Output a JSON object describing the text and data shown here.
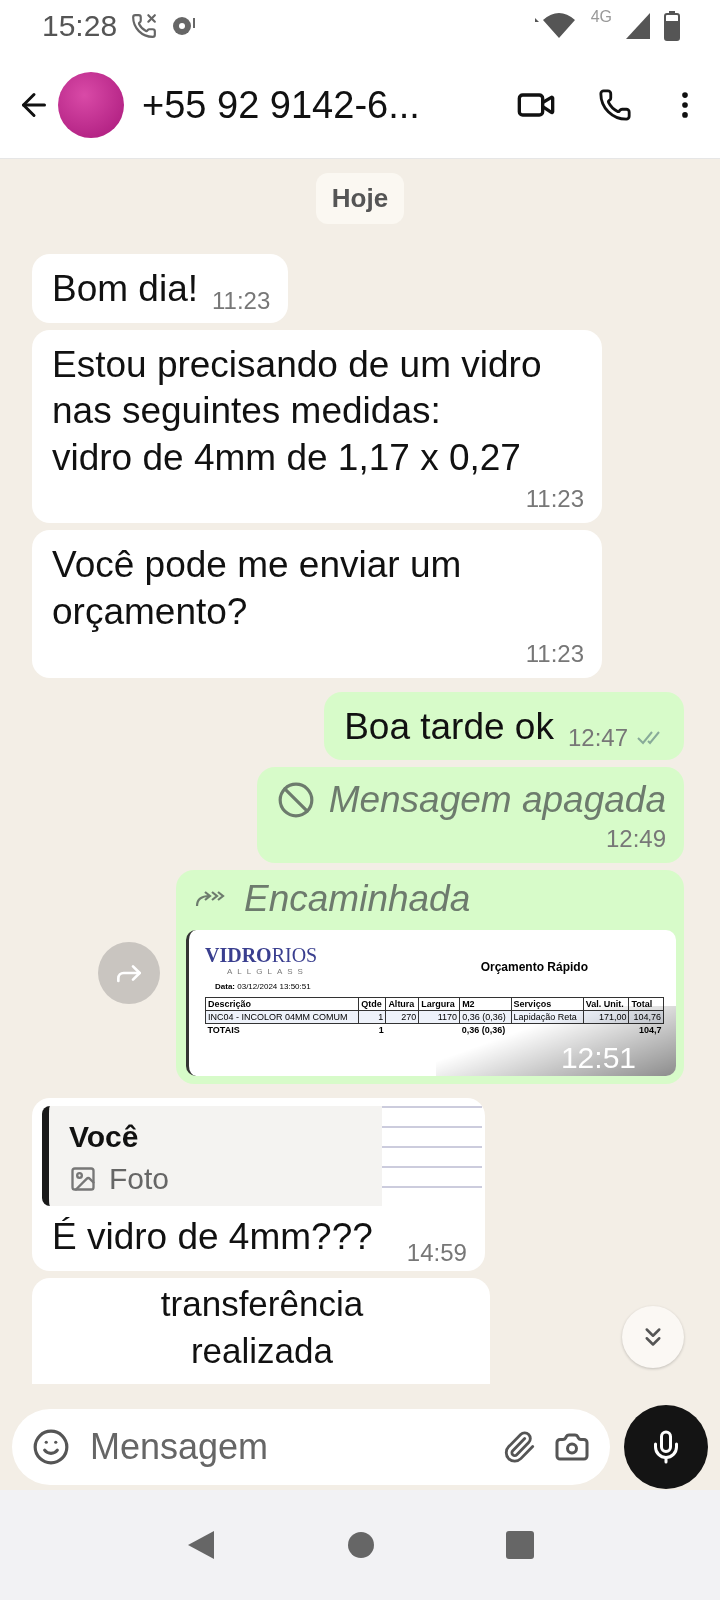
{
  "status_bar": {
    "time": "15:28",
    "network": "4G"
  },
  "header": {
    "title": "+55 92 9142-6..."
  },
  "date_chip": "Hoje",
  "messages": [
    {
      "kind": "text",
      "outgoing": false,
      "text": "Bom dia!",
      "time": "11:23",
      "time_below": false
    },
    {
      "kind": "text",
      "outgoing": false,
      "text": "Estou precisando de um vidro nas seguintes medidas:\nvidro de 4mm de 1,17 x 0,27",
      "time": "11:23",
      "time_below": true
    },
    {
      "kind": "text",
      "outgoing": false,
      "text": "Você pode me enviar um orçamento?",
      "time": "11:23",
      "time_below": true
    },
    {
      "kind": "text",
      "outgoing": true,
      "text": "Boa tarde ok",
      "time": "12:47",
      "time_below": false,
      "read": true
    },
    {
      "kind": "deleted",
      "outgoing": true,
      "text": "Mensagem apagada",
      "time": "12:49"
    },
    {
      "kind": "forwarded_image",
      "outgoing": true,
      "label": "Encaminhada",
      "time": "12:51",
      "document": {
        "logo": "**VIDRO**RIOS",
        "logo_sub": "ALLGLASS",
        "title": "Orçamento Rápido",
        "date_label": "Data:",
        "date": "03/12/2024 13:50:51",
        "columns": [
          "Descrição",
          "Qtde",
          "Altura",
          "Largura",
          "M2",
          "Serviços",
          "Val. Unit.",
          "Total"
        ],
        "rows": [
          [
            "INC04 - INCOLOR 04MM COMUM",
            "1",
            "270",
            "1170",
            "0,36 (0,36)",
            "Lapidação Reta",
            "171,00",
            "104,76"
          ]
        ],
        "totals": {
          "label": "TOTAIS",
          "qtde": "1",
          "m2": "0,36 (0,36)",
          "total": "104,7"
        }
      }
    },
    {
      "kind": "reply",
      "outgoing": false,
      "quote_author": "Você",
      "quote_text": "Foto",
      "text": "É vidro de 4mm???",
      "time": "14:59"
    },
    {
      "kind": "image_text",
      "outgoing": false,
      "text": "transferência realizada"
    }
  ],
  "composer": {
    "placeholder": "Mensagem"
  }
}
